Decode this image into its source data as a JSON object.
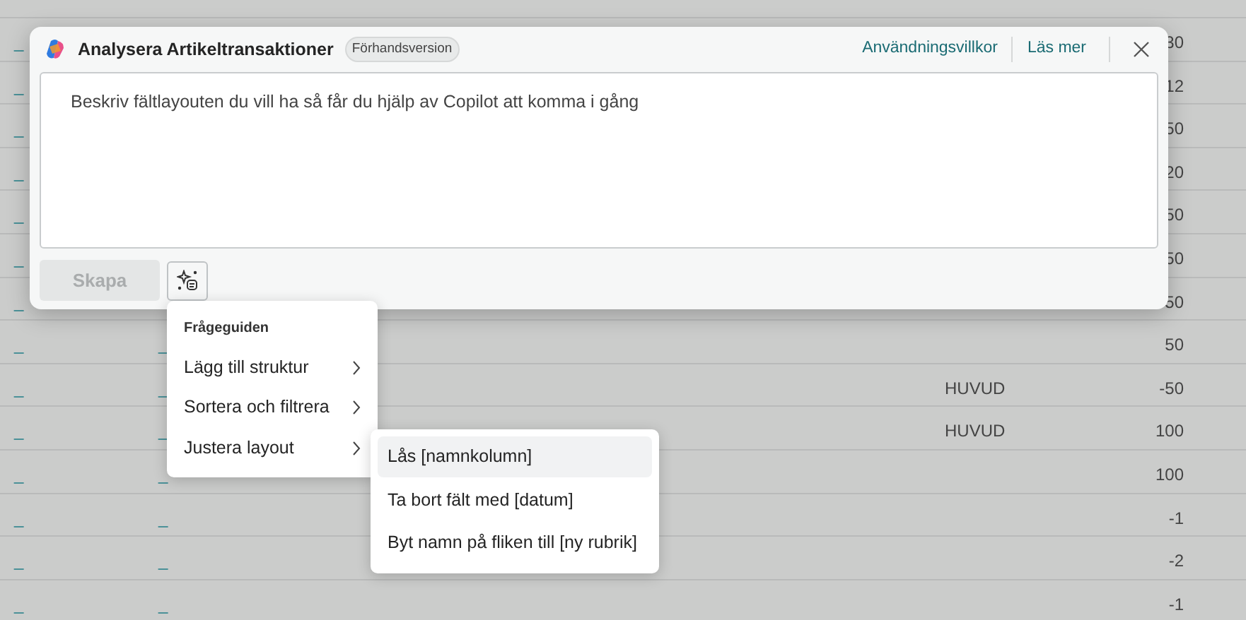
{
  "table": {
    "rows": [
      {
        "column_1": "_",
        "column_4": "30"
      },
      {
        "column_1": "_",
        "column_4": "12"
      },
      {
        "column_1": "_",
        "column_4": "50"
      },
      {
        "column_1": "_",
        "column_4": "20"
      },
      {
        "column_1": "_",
        "column_4": "50"
      },
      {
        "column_1": "_",
        "column_4": "50"
      },
      {
        "column_1": "_",
        "column_4": "50"
      },
      {
        "column_1": "_",
        "column_2": "_",
        "column_4": "50"
      },
      {
        "column_1": "_",
        "column_2": "_",
        "column_3": "HUVUD",
        "column_4": "-50"
      },
      {
        "column_1": "_",
        "column_2": "_",
        "column_3": "HUVUD",
        "column_4": "100"
      },
      {
        "column_1": "_",
        "column_2": "_",
        "column_4": "100"
      },
      {
        "column_1": "_",
        "column_2": "_",
        "column_4": "-1"
      },
      {
        "column_1": "_",
        "column_2": "_",
        "column_4": "-2"
      },
      {
        "column_1": "_",
        "column_2": "_",
        "column_4": "-1"
      }
    ]
  },
  "dialog": {
    "title": "Analysera Artikeltransaktioner",
    "badge": "Förhandsversion",
    "links": [
      "Användningsvillkor",
      "Läs mer"
    ],
    "prompt": {
      "placeholder": "Beskriv fältlayouten du vill ha så får du hjälp av Copilot att komma i gång"
    },
    "create_button": {
      "label": "Skapa",
      "disabled": true
    }
  },
  "prompt_guide_menu": {
    "title": "Frågeguiden",
    "items": [
      {
        "label": "Lägg till struktur"
      },
      {
        "label": "Sortera och filtrera"
      },
      {
        "label": "Justera layout",
        "children": [
          {
            "label": "Lås [namnkolumn]",
            "selected": true
          },
          {
            "label": "Ta bort fält med [datum]",
            "selected": false
          },
          {
            "label": "Byt namn på fliken till [ny rubrik]",
            "selected": false
          }
        ]
      }
    ]
  }
}
